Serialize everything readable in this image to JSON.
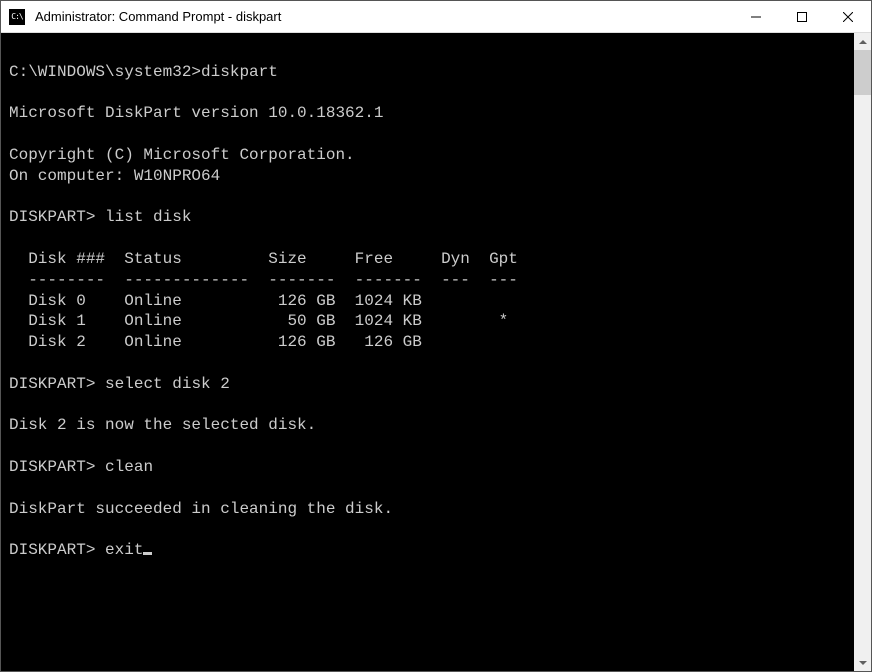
{
  "titlebar": {
    "icon_text": "C:\\",
    "title": "Administrator: Command Prompt - diskpart"
  },
  "terminal": {
    "prompt_path": "C:\\WINDOWS\\system32>",
    "cmd1": "diskpart",
    "version_line": "Microsoft DiskPart version 10.0.18362.1",
    "copyright_line": "Copyright (C) Microsoft Corporation.",
    "computer_line": "On computer: W10NPRO64",
    "dp_prompt": "DISKPART>",
    "cmd2": "list disk",
    "table": {
      "header": "  Disk ###  Status         Size     Free     Dyn  Gpt",
      "separator": "  --------  -------------  -------  -------  ---  ---",
      "rows": [
        "  Disk 0    Online          126 GB  1024 KB            ",
        "  Disk 1    Online           50 GB  1024 KB        *   ",
        "  Disk 2    Online          126 GB   126 GB            "
      ]
    },
    "cmd3": "select disk 2",
    "select_result": "Disk 2 is now the selected disk.",
    "cmd4": "clean",
    "clean_result": "DiskPart succeeded in cleaning the disk.",
    "cmd5": "exit"
  }
}
